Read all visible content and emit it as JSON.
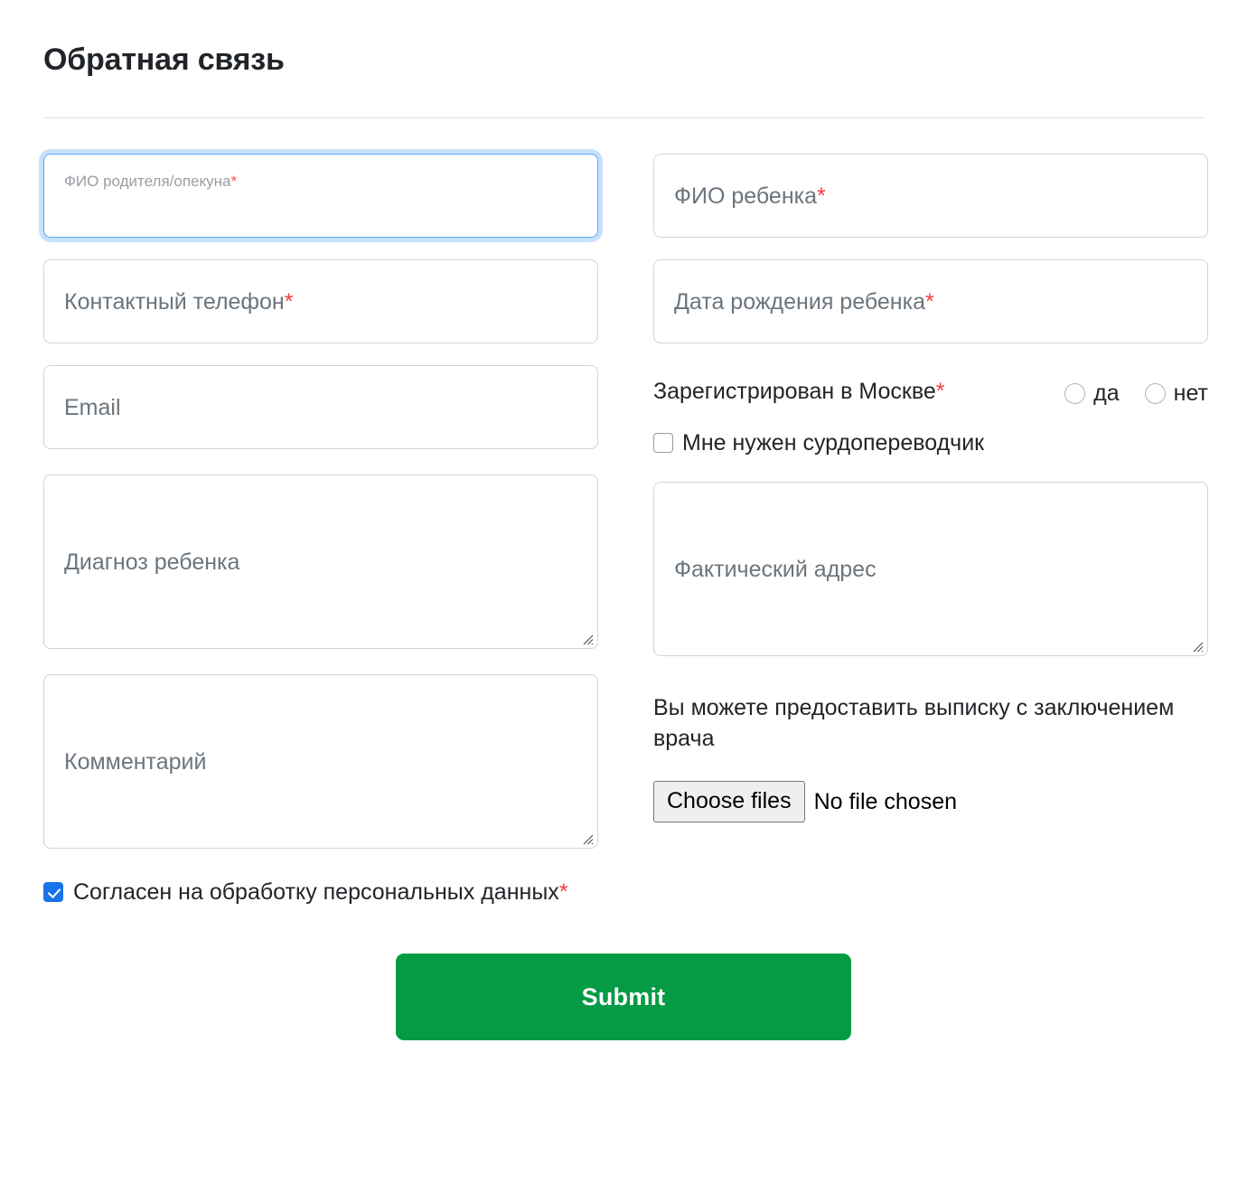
{
  "header": {
    "title": "Обратная связь"
  },
  "form": {
    "left": {
      "parent_name": {
        "placeholder": "ФИО родителя/опекуна",
        "required_mark": "*",
        "value": "",
        "focused": true
      },
      "phone": {
        "placeholder": "Контактный телефон",
        "required_mark": "*",
        "value": ""
      },
      "email": {
        "placeholder": "Email",
        "required_mark": "",
        "value": ""
      },
      "diagnosis": {
        "placeholder": "Диагноз ребенка",
        "required_mark": "",
        "value": ""
      },
      "comment": {
        "placeholder": "Комментарий",
        "required_mark": "",
        "value": ""
      }
    },
    "right": {
      "child_name": {
        "placeholder": "ФИО ребенка",
        "required_mark": "*",
        "value": ""
      },
      "child_birthdate": {
        "placeholder": "Дата рождения ребенка",
        "required_mark": "*",
        "value": ""
      },
      "registered_moscow": {
        "label": "Зарегистрирован в Москве",
        "required_mark": "*",
        "options": [
          {
            "label": "да",
            "checked": false
          },
          {
            "label": "нет",
            "checked": false
          }
        ]
      },
      "sign_interpreter": {
        "label": "Мне нужен сурдопереводчик",
        "checked": false
      },
      "address": {
        "placeholder": "Фактический адрес",
        "required_mark": "",
        "value": ""
      },
      "upload": {
        "note": "Вы можете предоставить выписку с заключением врача",
        "button_label": "Choose files",
        "status": "No file chosen"
      }
    },
    "consent": {
      "label": "Согласен на обработку персональных данных",
      "required_mark": "*",
      "checked": true
    },
    "submit": {
      "label": "Submit"
    }
  },
  "colors": {
    "accent_green": "#059a44",
    "required_red": "#fa5252",
    "focus_blue": "#5aa9f8",
    "checkbox_blue": "#1a73e8",
    "border_gray": "#ced4da",
    "placeholder_gray": "#6c757d",
    "text_dark": "#212529"
  }
}
